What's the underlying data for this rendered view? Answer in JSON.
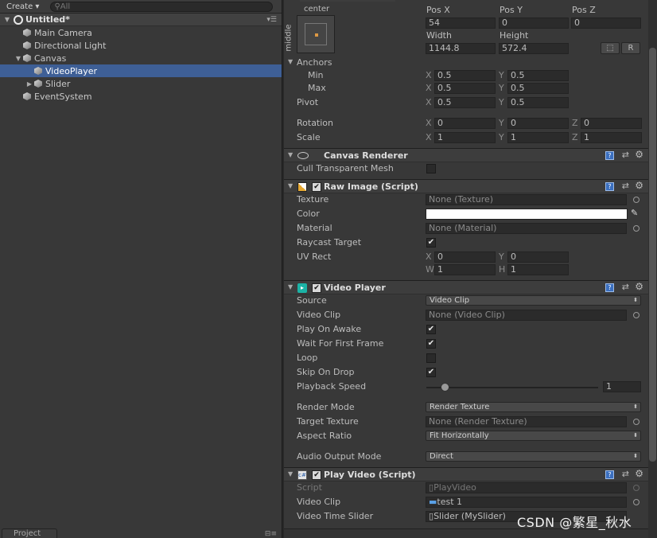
{
  "hierarchy": {
    "create_label": "Create",
    "search_placeholder": "All",
    "scene_name": "Untitled*",
    "items": [
      {
        "label": "Main Camera"
      },
      {
        "label": "Directional Light"
      },
      {
        "label": "Canvas"
      },
      {
        "label": "VideoPlayer"
      },
      {
        "label": "Slider"
      },
      {
        "label": "EventSystem"
      }
    ],
    "bottom_tab": "Project"
  },
  "rect_transform": {
    "anchor_h": "center",
    "anchor_v": "middle",
    "pos_x_label": "Pos X",
    "pos_y_label": "Pos Y",
    "pos_z_label": "Pos Z",
    "pos_x": "54",
    "pos_y": "0",
    "pos_z": "0",
    "width_label": "Width",
    "height_label": "Height",
    "width": "1144.8",
    "height": "572.4",
    "r_button": "R",
    "anchors_label": "Anchors",
    "min_label": "Min",
    "max_label": "Max",
    "min_x": "0.5",
    "min_y": "0.5",
    "max_x": "0.5",
    "max_y": "0.5",
    "pivot_label": "Pivot",
    "pivot_x": "0.5",
    "pivot_y": "0.5",
    "rotation_label": "Rotation",
    "rot_x": "0",
    "rot_y": "0",
    "rot_z": "0",
    "scale_label": "Scale",
    "scale_x": "1",
    "scale_y": "1",
    "scale_z": "1",
    "axis_x": "X",
    "axis_y": "Y",
    "axis_z": "Z",
    "axis_w": "W",
    "axis_h": "H"
  },
  "canvas_renderer": {
    "title": "Canvas Renderer",
    "cull_label": "Cull Transparent Mesh"
  },
  "raw_image": {
    "title": "Raw Image (Script)",
    "texture_label": "Texture",
    "texture_value": "None (Texture)",
    "color_label": "Color",
    "color_value": "#ffffff",
    "material_label": "Material",
    "material_value": "None (Material)",
    "raycast_label": "Raycast Target",
    "uvrect_label": "UV Rect",
    "uv_x": "0",
    "uv_y": "0",
    "uv_w": "1",
    "uv_h": "1"
  },
  "video_player": {
    "title": "Video Player",
    "source_label": "Source",
    "source_value": "Video Clip",
    "clip_label": "Video Clip",
    "clip_value": "None (Video Clip)",
    "awake_label": "Play On Awake",
    "wait_label": "Wait For First Frame",
    "loop_label": "Loop",
    "skip_label": "Skip On Drop",
    "speed_label": "Playback Speed",
    "speed_value": "1",
    "render_mode_label": "Render Mode",
    "render_mode_value": "Render Texture",
    "target_texture_label": "Target Texture",
    "target_texture_value": "None (Render Texture)",
    "aspect_label": "Aspect Ratio",
    "aspect_value": "Fit Horizontally",
    "audio_label": "Audio Output Mode",
    "audio_value": "Direct"
  },
  "play_video": {
    "title": "Play Video (Script)",
    "script_label": "Script",
    "script_value": "PlayVideo",
    "clip_label": "Video Clip",
    "clip_value": "test 1",
    "slider_label": "Video Time Slider",
    "slider_value": "Slider (MySlider)"
  },
  "watermark": "CSDN @繁星_秋水",
  "colors": {
    "selection": "#3e5f96",
    "panel": "#383838",
    "field": "#2b2b2b"
  }
}
